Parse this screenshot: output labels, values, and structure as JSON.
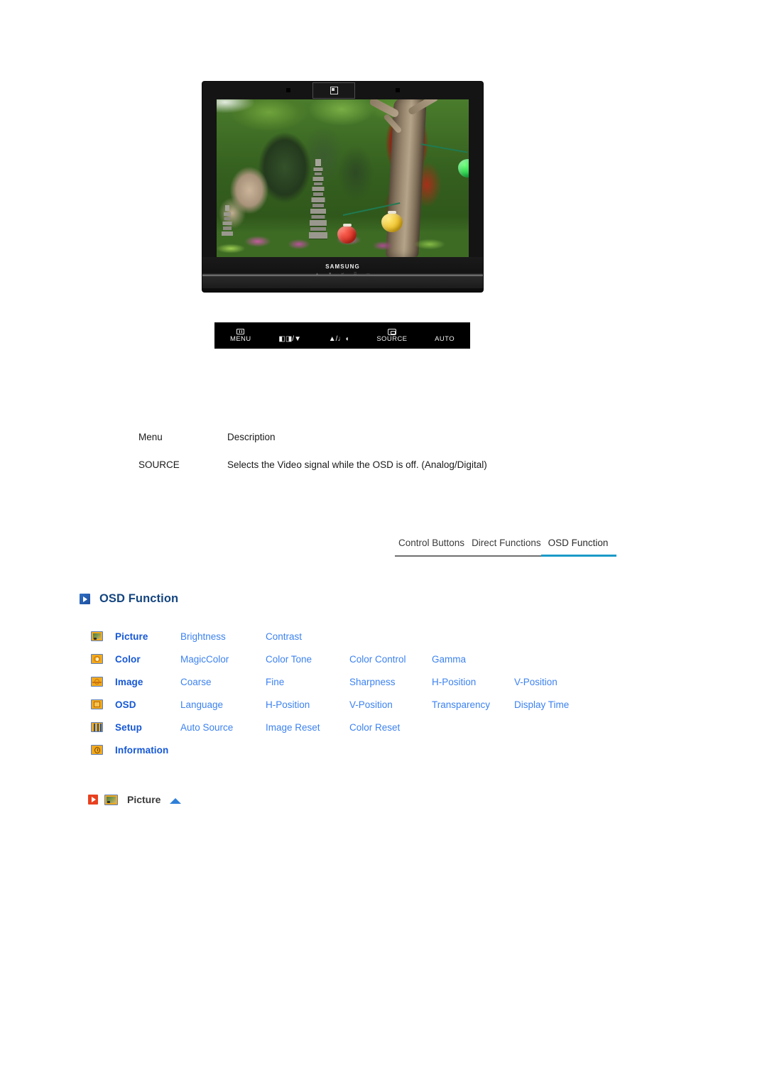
{
  "product": {
    "brand": "SAMSUNG",
    "bezel_badge_icon": "power-indicator-icon",
    "mini_key_labels": [
      "▲",
      "▼",
      "↵",
      "☲",
      "—"
    ]
  },
  "control_buttons": [
    {
      "label": "MENU",
      "icon": "menu-bars-icon",
      "glyph": ""
    },
    {
      "label": "◧◨/▼",
      "icon": "brightness-down-icon",
      "glyph": ""
    },
    {
      "label": "▲/♩◖",
      "icon": "volume-up-icon",
      "glyph": ""
    },
    {
      "label": "SOURCE",
      "icon": "source-icon",
      "glyph": ""
    },
    {
      "label": "AUTO",
      "icon": "",
      "glyph": ""
    }
  ],
  "description_table": {
    "headers": {
      "menu": "Menu",
      "description": "Description"
    },
    "rows": [
      {
        "menu": "SOURCE",
        "description": "Selects the Video signal while the OSD is off. (Analog/Digital)"
      }
    ]
  },
  "tabs": [
    {
      "label": "Control Buttons",
      "active": false
    },
    {
      "label": "Direct Functions",
      "active": false
    },
    {
      "label": "OSD Function",
      "active": true
    }
  ],
  "section": {
    "title": "OSD Function",
    "arrow_icon": "blue-play-arrow-icon"
  },
  "osd_map": [
    {
      "icon": "picture-menu-icon",
      "label": "Picture",
      "items": [
        "Brightness",
        "Contrast",
        "",
        "",
        ""
      ]
    },
    {
      "icon": "color-menu-icon",
      "label": "Color",
      "items": [
        "MagicColor",
        "Color Tone",
        "Color Control",
        "Gamma",
        ""
      ]
    },
    {
      "icon": "image-menu-icon",
      "label": "Image",
      "items": [
        "Coarse",
        "Fine",
        "Sharpness",
        "H-Position",
        "V-Position"
      ]
    },
    {
      "icon": "osd-menu-icon",
      "label": "OSD",
      "items": [
        "Language",
        "H-Position",
        "V-Position",
        "Transparency",
        "Display Time"
      ]
    },
    {
      "icon": "setup-menu-icon",
      "label": "Setup",
      "items": [
        "Auto Source",
        "Image Reset",
        "Color Reset",
        "",
        ""
      ]
    },
    {
      "icon": "information-menu-icon",
      "label": "Information",
      "items": [
        "",
        "",
        "",
        "",
        ""
      ]
    }
  ],
  "picture_detail": {
    "play_icon": "red-play-arrow-icon",
    "menu_icon": "picture-menu-icon",
    "label": "Picture",
    "collapse_icon": "blue-up-triangle-icon"
  },
  "colors": {
    "link_blue": "#3c82f0",
    "label_blue": "#1557d6",
    "heading_blue": "#14457f",
    "active_tab_underline": "#1b9ac8",
    "inactive_tab_underline": "#6f6f6f",
    "icon_orange": "#f0a91e",
    "red_accent": "#e8401f"
  }
}
